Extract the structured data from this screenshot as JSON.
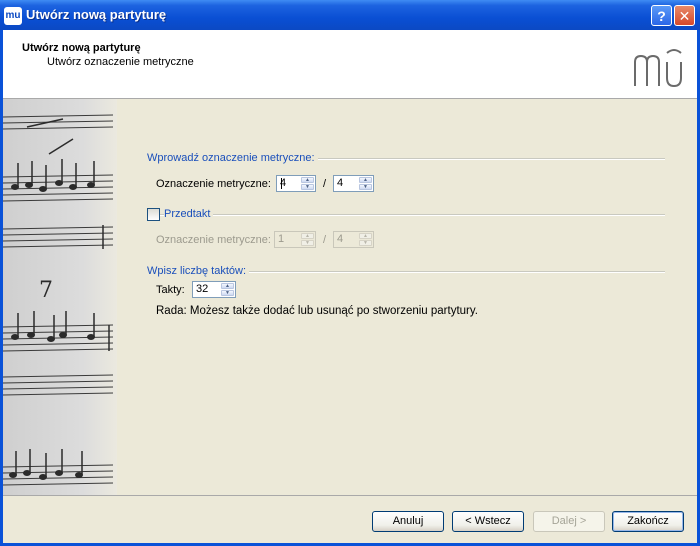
{
  "window": {
    "title": "Utwórz nową partyturę",
    "app_icon_text": "mu",
    "help_label": "?",
    "close_label": "✕"
  },
  "header": {
    "title": "Utwórz nową partyturę",
    "subtitle": "Utwórz oznaczenie metryczne"
  },
  "meter": {
    "group_label": "Wprowadź oznaczenie metryczne:",
    "field_label": "Oznaczenie metryczne:",
    "numerator": "4",
    "denominator": "4",
    "separator": "/"
  },
  "pickup": {
    "checkbox_label": "Przedtakt",
    "checked": false,
    "field_label": "Oznaczenie metryczne:",
    "numerator": "1",
    "denominator": "4",
    "separator": "/"
  },
  "measures": {
    "group_label": "Wpisz liczbę taktów:",
    "field_label": "Takty:",
    "value": "32",
    "tip": "Rada: Możesz także dodać lub usunąć po stworzeniu partytury."
  },
  "buttons": {
    "cancel": "Anuluj",
    "back": "< Wstecz",
    "next": "Dalej >",
    "finish": "Zakończ"
  },
  "icons": [
    "help-icon",
    "close-icon",
    "app-logo-icon",
    "spin-up-icon",
    "spin-down-icon"
  ]
}
